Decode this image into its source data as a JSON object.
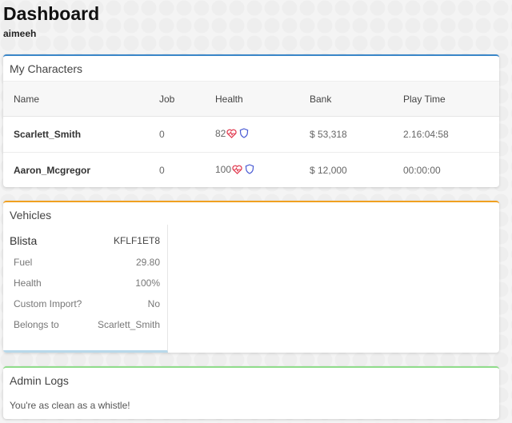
{
  "header": {
    "title": "Dashboard",
    "user": "aimeeh"
  },
  "characters": {
    "title": "My Characters",
    "columns": [
      "Name",
      "Job",
      "Health",
      "Bank",
      "Play Time"
    ],
    "rows": [
      {
        "name": "Scarlett_Smith",
        "job": "0",
        "health": "82",
        "bank": "$ 53,318",
        "play_time": "2.16:04:58"
      },
      {
        "name": "Aaron_Mcgregor",
        "job": "0",
        "health": "100",
        "bank": "$ 12,000",
        "play_time": "00:00:00"
      }
    ]
  },
  "vehicles": {
    "title": "Vehicles",
    "items": [
      {
        "name": "Blista",
        "plate": "KFLF1ET8",
        "fields": [
          {
            "label": "Fuel",
            "value": "29.80"
          },
          {
            "label": "Health",
            "value": "100%"
          },
          {
            "label": "Custom Import?",
            "value": "No"
          },
          {
            "label": "Belongs to",
            "value": "Scarlett_Smith"
          }
        ]
      }
    ]
  },
  "admin_logs": {
    "title": "Admin Logs",
    "message": "You're as clean as a whistle!"
  },
  "icons": {
    "health": "heart-pulse-icon",
    "armor": "shield-icon"
  },
  "colors": {
    "characters_accent": "#3a86c8",
    "vehicles_accent": "#f0a020",
    "admin_accent": "#8fdc8a",
    "heart": "#e0344a",
    "shield": "#4a5bd4"
  }
}
